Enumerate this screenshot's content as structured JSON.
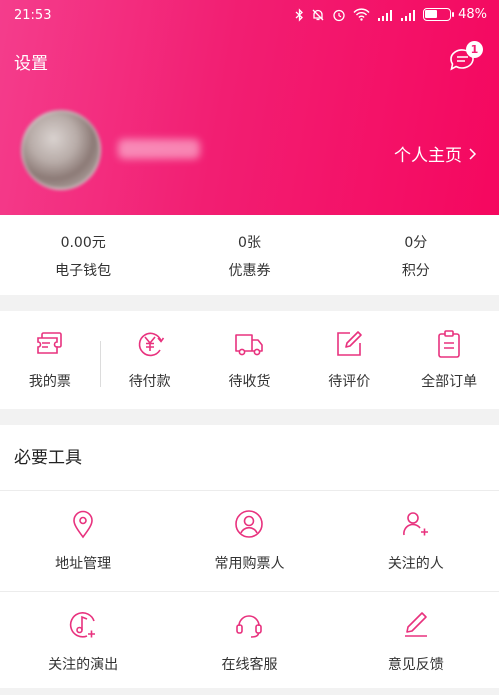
{
  "status_bar": {
    "time": "21:53",
    "battery": "48%"
  },
  "header": {
    "settings_label": "设置",
    "message_badge": "1",
    "profile_link": "个人主页"
  },
  "stats": [
    {
      "value": "0.00元",
      "label": "电子钱包"
    },
    {
      "value": "0张",
      "label": "优惠券"
    },
    {
      "value": "0分",
      "label": "积分"
    }
  ],
  "orders": [
    {
      "label": "我的票",
      "icon": "ticket-icon"
    },
    {
      "label": "待付款",
      "icon": "yen-icon"
    },
    {
      "label": "待收货",
      "icon": "truck-icon"
    },
    {
      "label": "待评价",
      "icon": "edit-icon"
    },
    {
      "label": "全部订单",
      "icon": "order-list-icon"
    }
  ],
  "tools": {
    "title": "必要工具",
    "items": [
      {
        "label": "地址管理",
        "icon": "location-icon"
      },
      {
        "label": "常用购票人",
        "icon": "user-circle-icon"
      },
      {
        "label": "关注的人",
        "icon": "add-user-icon"
      },
      {
        "label": "关注的演出",
        "icon": "music-note-icon"
      },
      {
        "label": "在线客服",
        "icon": "headset-icon"
      },
      {
        "label": "意见反馈",
        "icon": "feedback-pen-icon"
      }
    ]
  },
  "colors": {
    "accent": "#f21e72",
    "icon": "#e8327e"
  }
}
